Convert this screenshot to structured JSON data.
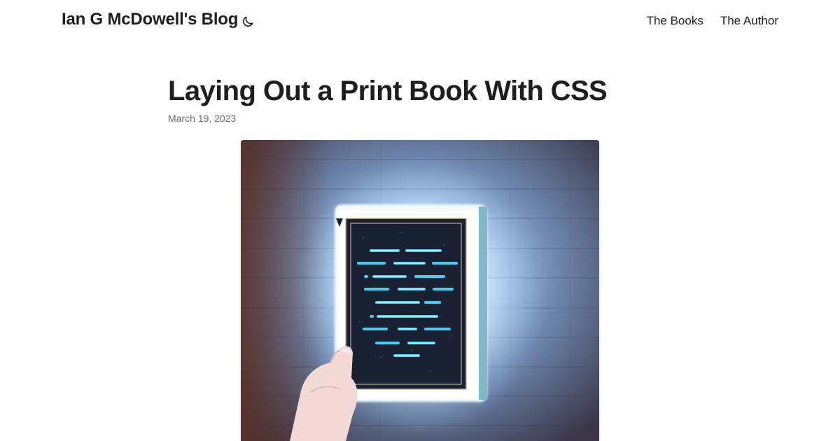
{
  "site": {
    "title": "Ian G McDowell's Blog",
    "theme_toggle_icon": "moon-icon"
  },
  "nav": {
    "items": [
      {
        "label": "The Books"
      },
      {
        "label": "The Author"
      }
    ]
  },
  "post": {
    "title": "Laying Out a Print Book With CSS",
    "date": "March 19, 2023",
    "cover_image": "glowing-book-in-hand-illustration"
  },
  "colors": {
    "text": "#1e1e1e",
    "muted": "#6b6b6b",
    "glow": "#8fd8ff",
    "wood": "#5d6f8f"
  }
}
